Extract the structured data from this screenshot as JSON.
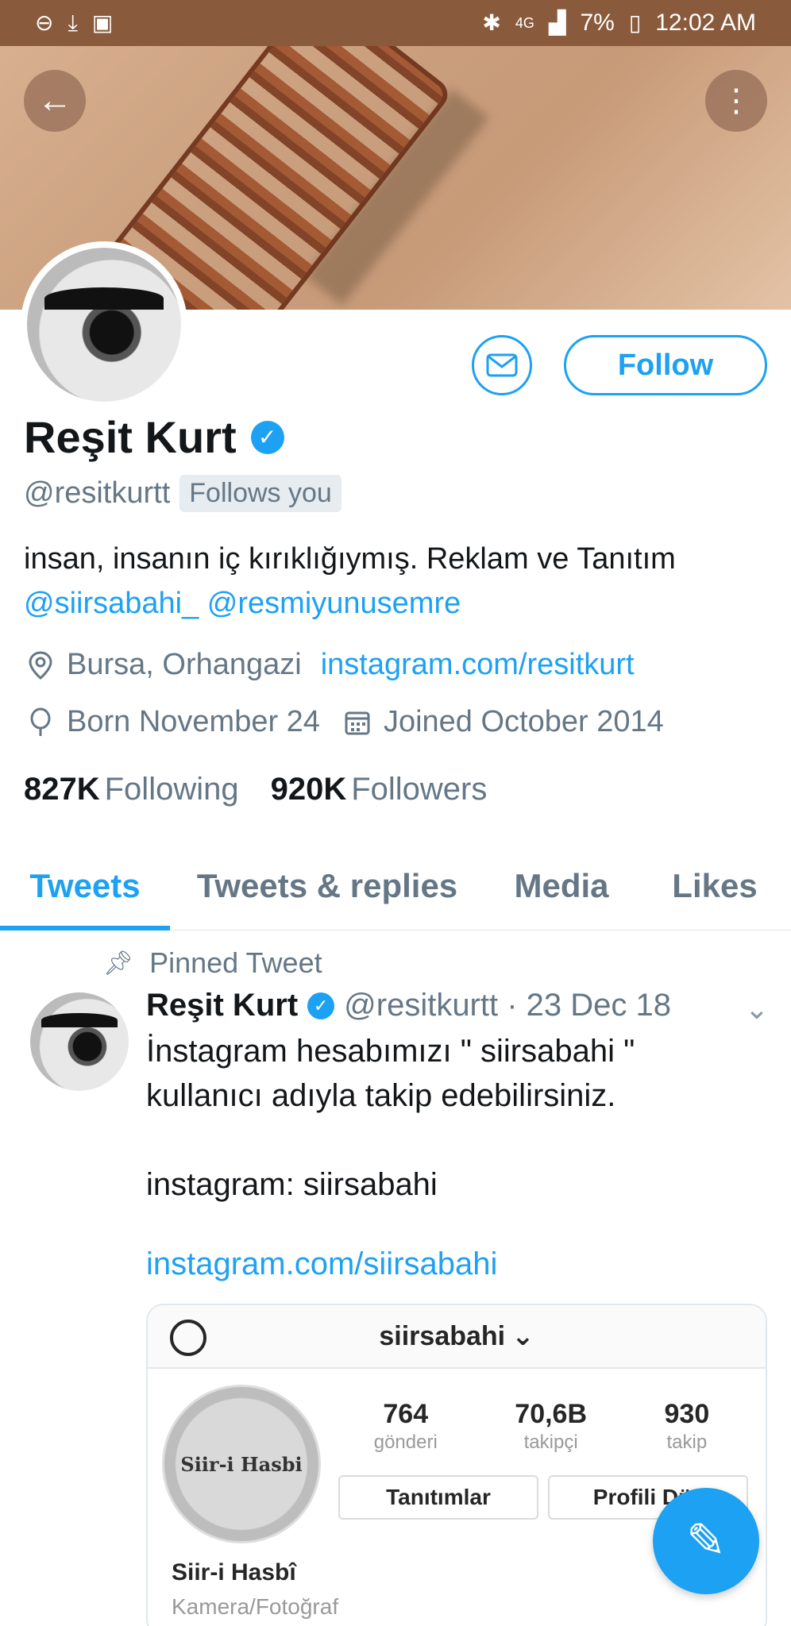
{
  "status_bar": {
    "time": "12:02 AM",
    "battery": "7%",
    "network": "4G",
    "icons_left": [
      "do-not-disturb-icon",
      "download-icon",
      "activity-icon"
    ],
    "icons_right": [
      "bluetooth-icon",
      "network-icon",
      "signal-icon",
      "battery-icon"
    ]
  },
  "header": {
    "back_icon": "arrow-left-icon",
    "more_icon": "more-vertical-icon"
  },
  "profile": {
    "name": "Reşit Kurt",
    "handle": "@resitkurtt",
    "follows_you": "Follows you",
    "follow_label": "Follow",
    "bio_text": "insan, insanın iç kırıklığıymış. Reklam ve Tanıtım",
    "bio_mention_1": "@siirsabahi_",
    "bio_mention_2": "@resmiyunusemre",
    "location": "Bursa, Orhangazi",
    "website": "instagram.com/resitkurt",
    "born": "Born November 24",
    "joined": "Joined October 2014",
    "following_count": "827K",
    "following_label": "Following",
    "followers_count": "920K",
    "followers_label": "Followers"
  },
  "tabs": [
    {
      "label": "Tweets",
      "active": true
    },
    {
      "label": "Tweets & replies",
      "active": false
    },
    {
      "label": "Media",
      "active": false
    },
    {
      "label": "Likes",
      "active": false
    }
  ],
  "pinned_tweet": {
    "pinned_label": "Pinned Tweet",
    "author_name": "Reşit Kurt",
    "meta": "@resitkurtt · 23 Dec 18",
    "text": "İnstagram hesabımızı \" siirsabahi \"\nkullanıcı adıyla takip edebilirsiniz.\n\ninstagram: siirsabahi",
    "link": "instagram.com/siirsabahi"
  },
  "instagram_card": {
    "username": "siirsabahi",
    "logo_text": "Siir-i Hasbi",
    "stats": [
      {
        "value": "764",
        "label": "gönderi"
      },
      {
        "value": "70,6B",
        "label": "takipçi"
      },
      {
        "value": "930",
        "label": "takip"
      }
    ],
    "btn_1": "Tanıtımlar",
    "btn_2": "Profili Düz",
    "display_name": "Siir-i Hasbî",
    "category": "Kamera/Fotoğraf"
  },
  "colors": {
    "accent": "#1da1f2",
    "status_bar": "#8a5a3c",
    "secondary_text": "#657786"
  }
}
